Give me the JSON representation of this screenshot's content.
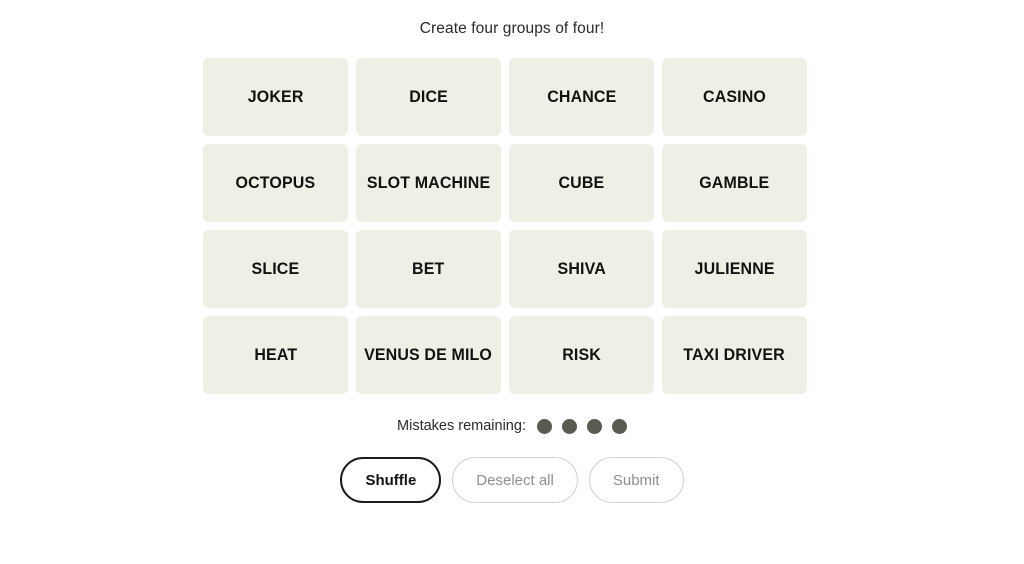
{
  "header": {
    "title": "Create four groups of four!"
  },
  "board": {
    "tiles": [
      {
        "label": "JOKER"
      },
      {
        "label": "DICE"
      },
      {
        "label": "CHANCE"
      },
      {
        "label": "CASINO"
      },
      {
        "label": "OCTOPUS"
      },
      {
        "label": "SLOT MACHINE"
      },
      {
        "label": "CUBE"
      },
      {
        "label": "GAMBLE"
      },
      {
        "label": "SLICE"
      },
      {
        "label": "BET"
      },
      {
        "label": "SHIVA"
      },
      {
        "label": "JULIENNE"
      },
      {
        "label": "HEAT"
      },
      {
        "label": "VENUS DE MILO"
      },
      {
        "label": "RISK"
      },
      {
        "label": "TAXI DRIVER"
      }
    ],
    "tile_color": "#efefe6",
    "tile_text_color": "#121212"
  },
  "mistakes": {
    "label": "Mistakes remaining:",
    "remaining": 4,
    "dot_color": "#5a5a50"
  },
  "actions": {
    "shuffle_label": "Shuffle",
    "deselect_label": "Deselect all",
    "submit_label": "Submit",
    "active_border_color": "#1a1a1a",
    "disabled_border_color": "#d2d2d2",
    "disabled_text_color": "#8e8e8e"
  }
}
